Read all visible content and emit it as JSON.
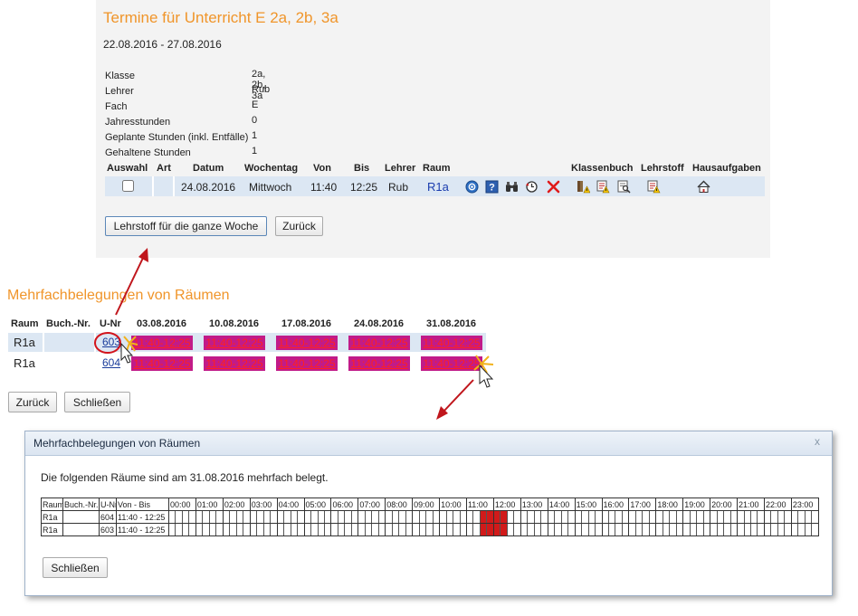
{
  "top": {
    "title": "Termine für Unterricht E 2a, 2b, 3a",
    "date_range": "22.08.2016 - 27.08.2016",
    "info": [
      {
        "label": "Klasse",
        "value": "2a, 2b, 3a"
      },
      {
        "label": "Lehrer",
        "value": "Rub"
      },
      {
        "label": "Fach",
        "value": "E"
      },
      {
        "label": "Jahresstunden",
        "value": "0"
      },
      {
        "label": "Geplante Stunden (inkl. Entfälle)",
        "value": "1"
      },
      {
        "label": "Gehaltene Stunden",
        "value": "1"
      }
    ],
    "columns": {
      "auswahl": "Auswahl",
      "art": "Art",
      "datum": "Datum",
      "wochentag": "Wochentag",
      "von": "Von",
      "bis": "Bis",
      "lehrer": "Lehrer",
      "raum": "Raum",
      "klassenbuch": "Klassenbuch",
      "lehrstoff": "Lehrstoff",
      "hausaufgaben": "Hausaufgaben"
    },
    "row": {
      "datum": "24.08.2016",
      "wochentag": "Mittwoch",
      "von": "11:40",
      "bis": "12:25",
      "lehrer": "Rub",
      "raum": "R1a",
      "action_icons": [
        "info-icon",
        "help-icon",
        "binoculars-icon",
        "history-icon",
        "delete-icon"
      ],
      "klassenbuch_icons": [
        "book-warning-icon",
        "list-warning-icon",
        "document-search-icon"
      ],
      "lehrstoff_icons": [
        "list-warning-icon"
      ],
      "hausaufgaben_icons": [
        "home-icon"
      ]
    },
    "buttons": {
      "whole_week": "Lehrstoff für die ganze Woche",
      "back": "Zurück"
    }
  },
  "middle": {
    "title": "Mehrfachbelegungen von Räumen",
    "columns": {
      "raum": "Raum",
      "buch_nr": "Buch.-Nr.",
      "u_nr": "U-Nr"
    },
    "dates": [
      "03.08.2016",
      "10.08.2016",
      "17.08.2016",
      "24.08.2016",
      "31.08.2016"
    ],
    "rows": [
      {
        "raum": "R1a",
        "u_nr": "603",
        "slots": [
          "11:40-12:25",
          "11:40-12:25",
          "11:40-12:25",
          "11:40-12:25",
          "11:40-12:25"
        ]
      },
      {
        "raum": "R1a",
        "u_nr": "604",
        "slots": [
          "11:40-12:25",
          "11:40-12:25",
          "11:40-12:25",
          "11:40-12:25",
          "11:40-12:25"
        ]
      }
    ],
    "buttons": {
      "back": "Zurück",
      "close": "Schließen"
    }
  },
  "dialog": {
    "title": "Mehrfachbelegungen von Räumen",
    "close_glyph": "x",
    "message": "Die folgenden Räume sind am 31.08.2016 mehrfach belegt.",
    "grid_headers": [
      "Raum",
      "Buch.-Nr.",
      "U-Nr",
      "Von - Bis"
    ],
    "hours": [
      "00:00",
      "01:00",
      "02:00",
      "03:00",
      "04:00",
      "05:00",
      "06:00",
      "07:00",
      "08:00",
      "09:00",
      "10:00",
      "11:00",
      "12:00",
      "13:00",
      "14:00",
      "15:00",
      "16:00",
      "17:00",
      "18:00",
      "19:00",
      "20:00",
      "21:00",
      "22:00",
      "23:00"
    ],
    "rows": [
      {
        "raum": "R1a",
        "u_nr": "604",
        "von_bis": "11:40 - 12:25"
      },
      {
        "raum": "R1a",
        "u_nr": "603",
        "von_bis": "11:40 - 12:25"
      }
    ],
    "occupied_hours": [
      "11:00",
      "12:00"
    ],
    "button_close": "Schließen"
  },
  "colors": {
    "accent_orange": "#f0952a",
    "slot_bg": "#c11b89",
    "slot_text": "#ff2020",
    "arrow": "#c0161c"
  }
}
